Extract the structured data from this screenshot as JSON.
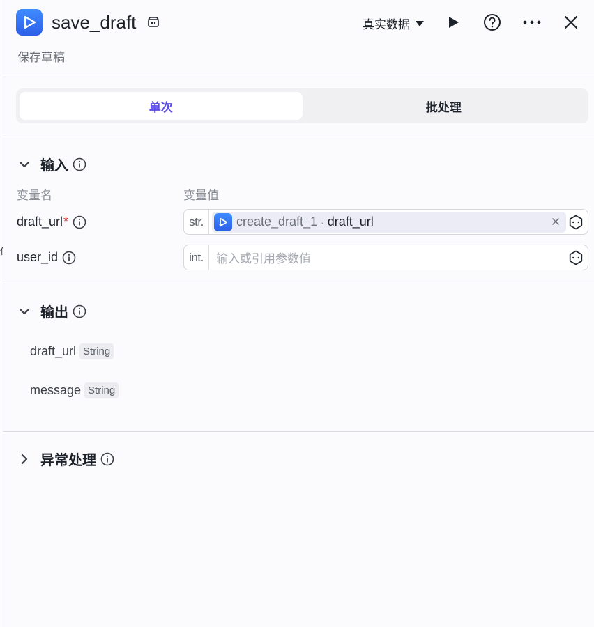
{
  "header": {
    "title": "save_draft",
    "subtitle": "保存草稿",
    "data_mode": "真实数据"
  },
  "tabs": [
    {
      "label": "单次",
      "active": true
    },
    {
      "label": "批处理",
      "active": false
    }
  ],
  "input_section": {
    "title": "输入",
    "col_name": "变量名",
    "col_value": "变量值",
    "params": [
      {
        "name": "draft_url",
        "required_mark": "*",
        "type": "str.",
        "ref_node": "create_draft_1",
        "ref_separator": "·",
        "ref_var": "draft_url"
      },
      {
        "name": "user_id",
        "type": "int.",
        "placeholder": "输入或引用参数值"
      }
    ]
  },
  "output_section": {
    "title": "输出",
    "items": [
      {
        "name": "draft_url",
        "type": "String"
      },
      {
        "name": "message",
        "type": "String"
      }
    ]
  },
  "exception_section": {
    "title": "异常处理"
  },
  "colors": {
    "accent": "#5a4ee6",
    "node_icon": "#2c5fe8",
    "required": "#e5383b"
  },
  "icons": {
    "node": "play-node-icon",
    "title": "store-icon",
    "run": "play-icon",
    "help": "help-icon",
    "more": "more-icon",
    "close": "close-icon",
    "info": "info-icon",
    "variable": "variable-hex-icon"
  }
}
